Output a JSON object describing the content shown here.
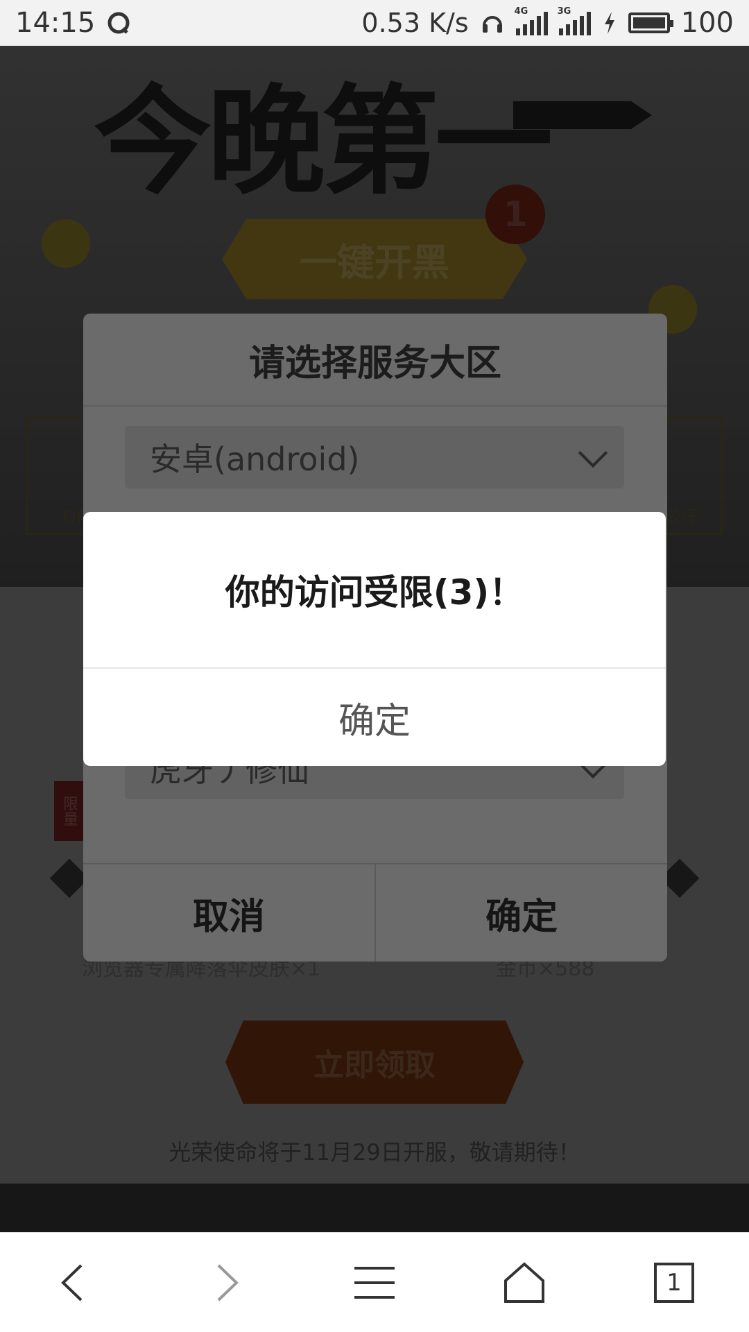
{
  "status_bar": {
    "time": "14:15",
    "network_speed": "0.53 K/s",
    "signal_1_tag": "4G",
    "signal_2_tag": "3G",
    "battery": "100"
  },
  "page": {
    "hero_title": "今晚第一",
    "hero_button": "一键开黑",
    "hero_badge": "1",
    "side_left_label": "OF",
    "side_right_label": "公仔",
    "limit_tag": "限量",
    "reward_left": "浏览器专属降落伞皮肤×1",
    "reward_right": "金币×588",
    "claim_button": "立即领取",
    "notice": "光荣使命将于11月29日开服，敬请期待！"
  },
  "server_dialog": {
    "title": "请选择服务大区",
    "platform_select": "安卓(android)",
    "server_select": "虎牙丿修仙",
    "cancel_label": "取消",
    "confirm_label": "确定"
  },
  "alert": {
    "message": "你的访问受限(3)！",
    "ok_label": "确定"
  },
  "navbar": {
    "tab_count": "1"
  },
  "icons": {
    "status": [
      "qq-icon",
      "headset-icon",
      "signal-icon",
      "charging-icon",
      "battery-icon"
    ],
    "nav": [
      "back-icon",
      "forward-icon",
      "menu-icon",
      "home-icon",
      "tabs-icon"
    ]
  }
}
